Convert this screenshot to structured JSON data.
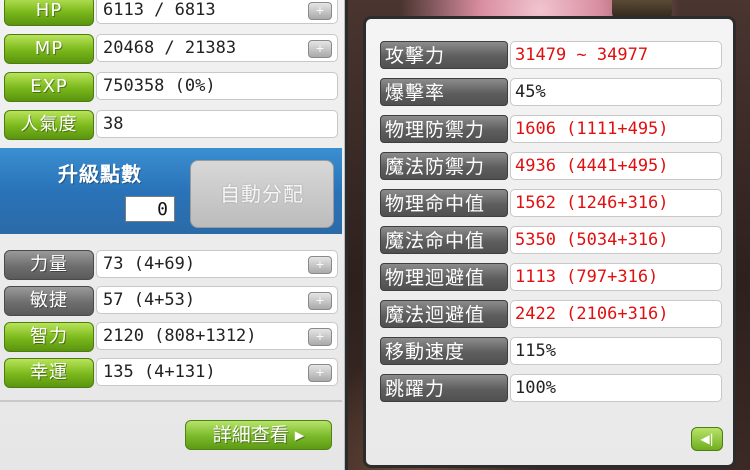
{
  "basic_stats": [
    {
      "label": "HP",
      "value": "6113 / 6813"
    },
    {
      "label": "MP",
      "value": "20468 / 21383"
    },
    {
      "label": "EXP",
      "value": "750358 (0%)"
    },
    {
      "label": "人氣度",
      "value": "38"
    }
  ],
  "ability_points": {
    "title": "升級點數",
    "value": "0",
    "auto_label": "自動分配"
  },
  "attributes": [
    {
      "label": "力量",
      "value": "73 (4+69)",
      "style": "gray"
    },
    {
      "label": "敏捷",
      "value": "57 (4+53)",
      "style": "gray"
    },
    {
      "label": "智力",
      "value": "2120 (808+1312)",
      "style": "green"
    },
    {
      "label": "幸運",
      "value": "135 (4+131)",
      "style": "green"
    }
  ],
  "detail_button": "詳細查看 ▸",
  "detail_stats": [
    {
      "label": "攻擊力",
      "value": "31479 ~ 34977",
      "color": "red"
    },
    {
      "label": "爆擊率",
      "value": "45%",
      "color": "black"
    },
    {
      "label": "物理防禦力",
      "value": "1606 (1111+495)",
      "color": "red"
    },
    {
      "label": "魔法防禦力",
      "value": "4936 (4441+495)",
      "color": "red"
    },
    {
      "label": "物理命中值",
      "value": "1562 (1246+316)",
      "color": "red"
    },
    {
      "label": "魔法命中值",
      "value": "5350 (5034+316)",
      "color": "red"
    },
    {
      "label": "物理迴避值",
      "value": "1113 (797+316)",
      "color": "red"
    },
    {
      "label": "魔法迴避值",
      "value": "2422 (2106+316)",
      "color": "red"
    },
    {
      "label": "移動速度",
      "value": "115%",
      "color": "black"
    },
    {
      "label": "跳躍力",
      "value": "100%",
      "color": "black"
    }
  ],
  "icons": {
    "plus": "plus-icon",
    "back": "back-arrow-icon"
  },
  "colors": {
    "green": "#79b71a",
    "accent_blue": "#2a73b8",
    "stat_red": "#e01010"
  }
}
